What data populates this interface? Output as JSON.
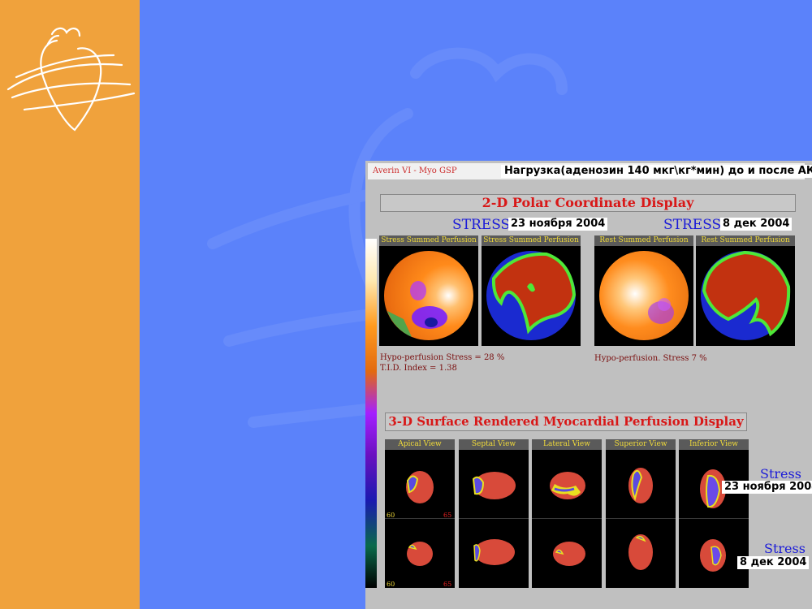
{
  "app": {
    "title": "Averin VI - Myo GSP"
  },
  "banner": "Нагрузка(аденозин 140 мкг\\кг*мин) до и после АКШ",
  "polar_section": {
    "title": "2-D Polar Coordinate Display",
    "groups": [
      {
        "label": "STRESS",
        "date": "23 ноября 2004"
      },
      {
        "label": "STRESS",
        "date": "8 дек 2004"
      }
    ],
    "panels": [
      {
        "title": "Stress Summed Perfusion"
      },
      {
        "title": "Stress Summed Perfusion"
      },
      {
        "title": "Rest Summed Perfusion"
      },
      {
        "title": "Rest Summed Perfusion"
      }
    ],
    "notes": {
      "left_line1": "Hypo-perfusion Stress = 28 %",
      "left_line2": "T.I.D. Index = 1.38",
      "right_line1": "Hypo-perfusion. Stress 7 %"
    }
  },
  "surface_section": {
    "title": "3-D Surface Rendered Myocardial Perfusion Display",
    "views": [
      "Apical View",
      "Septal View",
      "Lateral View",
      "Superior View",
      "Inferior View"
    ],
    "rows": [
      {
        "label": "Stress",
        "date": "23 ноября 2004"
      },
      {
        "label": "Stress",
        "date": "8 дек 2004"
      }
    ],
    "scale": {
      "low": "60",
      "high": "65"
    }
  },
  "colors": {
    "background": "#5b82fa",
    "left_band": "#f0a23c",
    "panel": "#c0c0c0",
    "title_red": "#d81818",
    "stress_blue": "#1b1bd8"
  }
}
